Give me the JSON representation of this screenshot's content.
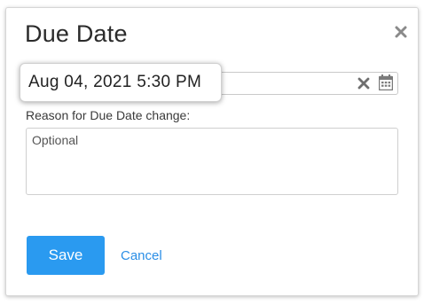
{
  "dialog": {
    "title": "Due Date",
    "close_icon": "close-icon"
  },
  "date_field": {
    "value": "Aug 04, 2021 5:30 PM",
    "clear_icon": "clear-x-icon",
    "calendar_icon": "calendar-icon"
  },
  "reason": {
    "label": "Reason for Due Date change:",
    "placeholder": "Optional",
    "value": ""
  },
  "actions": {
    "save_label": "Save",
    "cancel_label": "Cancel"
  },
  "colors": {
    "primary": "#2a9af0",
    "link": "#2a8ee6",
    "icon": "#7a7a7a"
  }
}
